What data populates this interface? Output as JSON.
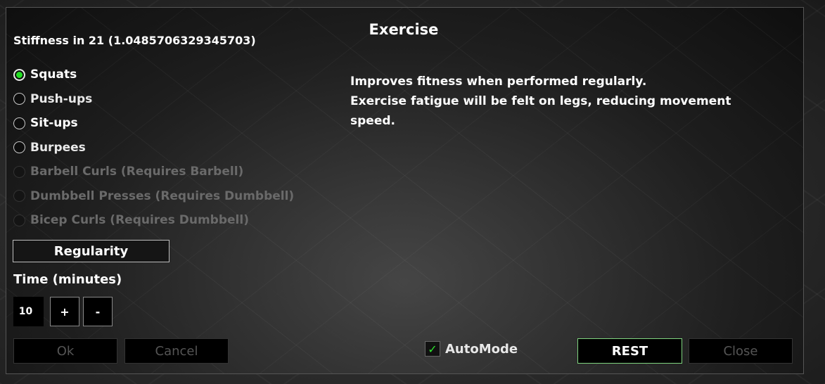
{
  "dialog": {
    "title": "Exercise",
    "stiffness": "Stiffness in 21 (1.0485706329345703)",
    "exercises": [
      {
        "label": "Squats",
        "state": "selected"
      },
      {
        "label": "Push-ups",
        "state": "dim"
      },
      {
        "label": "Sit-ups",
        "state": "enabled"
      },
      {
        "label": "Burpees",
        "state": "dim"
      },
      {
        "label": "Barbell Curls (Requires Barbell)",
        "state": "disabled"
      },
      {
        "label": "Dumbbell Presses (Requires Dumbbell)",
        "state": "disabled"
      },
      {
        "label": "Bicep Curls (Requires Dumbbell)",
        "state": "disabled"
      }
    ],
    "regularity_label": "Regularity",
    "time_label": "Time (minutes)",
    "time_value": "10",
    "plus_label": "+",
    "minus_label": "-",
    "description_lines": [
      "Improves fitness when performed regularly.",
      "Exercise fatigue will be felt on legs, reducing movement",
      "speed."
    ],
    "automode_label": "AutoMode",
    "automode_checked": true,
    "buttons": {
      "ok": "Ok",
      "cancel": "Cancel",
      "rest": "REST",
      "close": "Close"
    }
  },
  "colors": {
    "selected_radio": "#22e022",
    "rest_border": "#7fd47f",
    "checkmark": "#2ee62e"
  }
}
